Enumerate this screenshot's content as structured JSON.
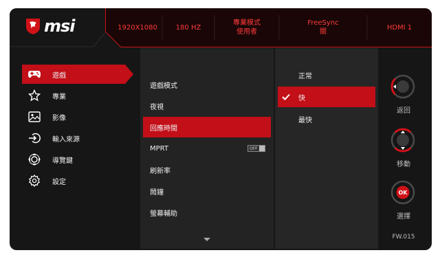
{
  "brand": {
    "logo_text": "msi"
  },
  "header": {
    "resolution": "1920X1080",
    "refresh": "180 HZ",
    "mode_line1": "專業模式",
    "mode_line2": "使用者",
    "freesync_line1": "FreeSync",
    "freesync_line2": "關",
    "input": "HDMI 1"
  },
  "main_menu": {
    "items": [
      {
        "label": "遊戲",
        "icon": "gamepad-icon",
        "active": true
      },
      {
        "label": "專業",
        "icon": "star-icon"
      },
      {
        "label": "影像",
        "icon": "image-icon"
      },
      {
        "label": "輸入來源",
        "icon": "input-source-icon"
      },
      {
        "label": "導覽鍵",
        "icon": "navi-key-icon"
      },
      {
        "label": "設定",
        "icon": "gear-icon"
      }
    ]
  },
  "sub_menu": {
    "items": [
      {
        "label": "遊戲模式"
      },
      {
        "label": "夜視"
      },
      {
        "label": "回應時間",
        "active": true
      },
      {
        "label": "MPRT",
        "toggle": "OFF"
      },
      {
        "label": "刷新率"
      },
      {
        "label": "鬧鐘"
      },
      {
        "label": "螢幕輔助"
      }
    ]
  },
  "options": {
    "items": [
      {
        "label": "正常"
      },
      {
        "label": "快",
        "selected": true
      },
      {
        "label": "最快"
      }
    ]
  },
  "nav": {
    "back_label": "返回",
    "move_label": "移動",
    "select_label": "選擇",
    "ok_text": "OK",
    "firmware": "FW.015"
  },
  "colors": {
    "accent": "#c20f18",
    "header_text": "#ff3a3a",
    "panel": "#232323"
  }
}
